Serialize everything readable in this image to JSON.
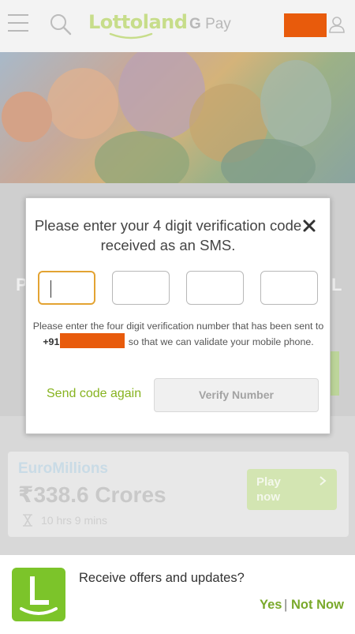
{
  "header": {
    "logo_text": "Lottoland",
    "gpay_g": "G",
    "gpay_text": "Pay",
    "icons": [
      "menu-icon",
      "search-icon",
      "user-icon"
    ]
  },
  "background": {
    "band_left_letter": "P",
    "band_right_letter": "L",
    "card": {
      "title": "EuroMillions",
      "amount": "₹338.6 Crores",
      "time_left": "10 hrs 9 mins",
      "play_label": "Play now"
    }
  },
  "modal": {
    "title": "Please enter your 4 digit verification code received as an SMS.",
    "help_before": "Please enter the four digit verification number that has been sent to ",
    "country_code": "+91",
    "help_after": " so that we can validate your mobile phone.",
    "send_again_label": "Send code again",
    "verify_label": "Verify Number",
    "code_digits": [
      "",
      "",
      "",
      ""
    ]
  },
  "offers": {
    "text": "Receive offers and updates?",
    "yes_label": "Yes",
    "separator": "|",
    "not_now_label": "Not Now"
  },
  "colors": {
    "accent_green": "#87b320",
    "redaction_orange": "#e85b0c",
    "active_input_border": "#e3a332"
  }
}
